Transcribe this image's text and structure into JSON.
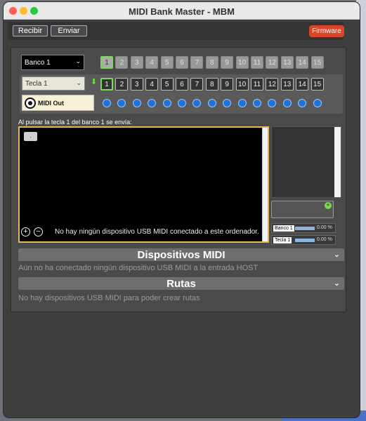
{
  "window": {
    "title": "MIDI Bank Master - MBM"
  },
  "toolbar": {
    "recibir": "Recibir",
    "enviar": "Enviar",
    "firmware": "Firmware"
  },
  "bank": {
    "selected": "Banco 1",
    "numbers": [
      "1",
      "2",
      "3",
      "4",
      "5",
      "6",
      "7",
      "8",
      "9",
      "10",
      "11",
      "12",
      "13",
      "14",
      "15"
    ],
    "active": "1"
  },
  "key": {
    "selected": "Tecla 1",
    "numbers": [
      "1",
      "2",
      "3",
      "4",
      "5",
      "6",
      "7",
      "8",
      "9",
      "10",
      "11",
      "12",
      "13",
      "14",
      "15"
    ],
    "active": "1"
  },
  "midi_out_label": "MIDI Out",
  "editor": {
    "label": "Al pulsar la tecla 1 del banco 1 se envía:",
    "tag": "."
  },
  "progress": {
    "banco_label": "Banco 1",
    "banco_value": "0.00 %",
    "tecla_label": "Tecla 1",
    "tecla_value": "0.00 %"
  },
  "usb": {
    "add_glyph": "+",
    "remove_glyph": "−",
    "message": "No hay ningún dispositivo USB MIDI conectado a este ordenador."
  },
  "sections": {
    "dispositivos": {
      "title": "Dispositivos MIDI",
      "message": "Aún no ha conectado ningún dispositivo USB MIDI a la entrada HOST"
    },
    "rutas": {
      "title": "Rutas",
      "message": "No hay dispositivos USB MIDI para poder crear rutas"
    }
  },
  "icons": {
    "chevron": "chevron-down-icon",
    "download": "download-icon",
    "midi_jack": "midi-din-icon"
  },
  "colors": {
    "accent_green": "#7ed957",
    "firmware_red": "#d9452b",
    "dot_blue": "#1f73d9",
    "editor_border": "#e3b75b"
  }
}
